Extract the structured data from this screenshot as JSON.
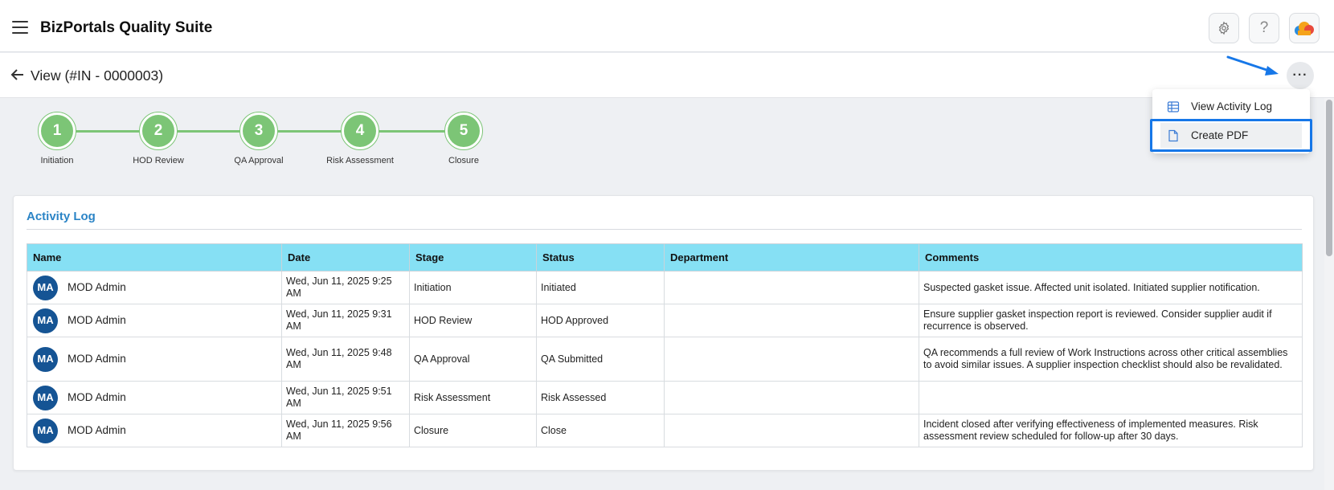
{
  "app": {
    "title": "BizPortals Quality Suite",
    "icons": [
      "hamburger-menu-icon",
      "gear-icon",
      "help-icon",
      "cloud-logo-icon"
    ]
  },
  "view": {
    "title": "View (#IN - 0000003)",
    "more_label": "···"
  },
  "menu": {
    "items": [
      {
        "label": "View Activity Log",
        "icon": "table-icon"
      },
      {
        "label": "Create PDF",
        "icon": "document-icon"
      }
    ]
  },
  "stepper": {
    "steps": [
      {
        "number": "1",
        "label": "Initiation"
      },
      {
        "number": "2",
        "label": "HOD Review"
      },
      {
        "number": "3",
        "label": "QA Approval"
      },
      {
        "number": "4",
        "label": "Risk Assessment"
      },
      {
        "number": "5",
        "label": "Closure"
      }
    ],
    "color": "#7cc576"
  },
  "activity": {
    "title": "Activity Log",
    "columns": [
      "Name",
      "Date",
      "Stage",
      "Status",
      "Department",
      "Comments"
    ],
    "rows": [
      {
        "initials": "MA",
        "name": "MOD Admin",
        "date": "Wed, Jun 11, 2025 9:25 AM",
        "stage": "Initiation",
        "status": "Initiated",
        "department": "",
        "comments": "Suspected gasket issue. Affected unit isolated. Initiated supplier notification."
      },
      {
        "initials": "MA",
        "name": "MOD Admin",
        "date": "Wed, Jun 11, 2025 9:31 AM",
        "stage": "HOD Review",
        "status": "HOD Approved",
        "department": "",
        "comments": "Ensure supplier gasket inspection report is reviewed. Consider supplier audit if recurrence is observed."
      },
      {
        "initials": "MA",
        "name": "MOD Admin",
        "date": "Wed, Jun 11, 2025 9:48 AM",
        "stage": "QA Approval",
        "status": "QA Submitted",
        "department": "",
        "comments": "QA recommends a full review of Work Instructions across other critical assemblies to avoid similar issues. A supplier inspection checklist should also be revalidated."
      },
      {
        "initials": "MA",
        "name": "MOD Admin",
        "date": "Wed, Jun 11, 2025 9:51 AM",
        "stage": "Risk Assessment",
        "status": "Risk Assessed",
        "department": "",
        "comments": ""
      },
      {
        "initials": "MA",
        "name": "MOD Admin",
        "date": "Wed, Jun 11, 2025 9:56 AM",
        "stage": "Closure",
        "status": "Close",
        "department": "",
        "comments": "Incident closed after verifying effectiveness of implemented measures. Risk assessment review scheduled for follow-up after 30 days."
      }
    ]
  },
  "colors": {
    "accent": "#2b84c6",
    "header_bg": "#86e0f4",
    "avatar_bg": "#155494",
    "highlight": "#1677e8"
  }
}
